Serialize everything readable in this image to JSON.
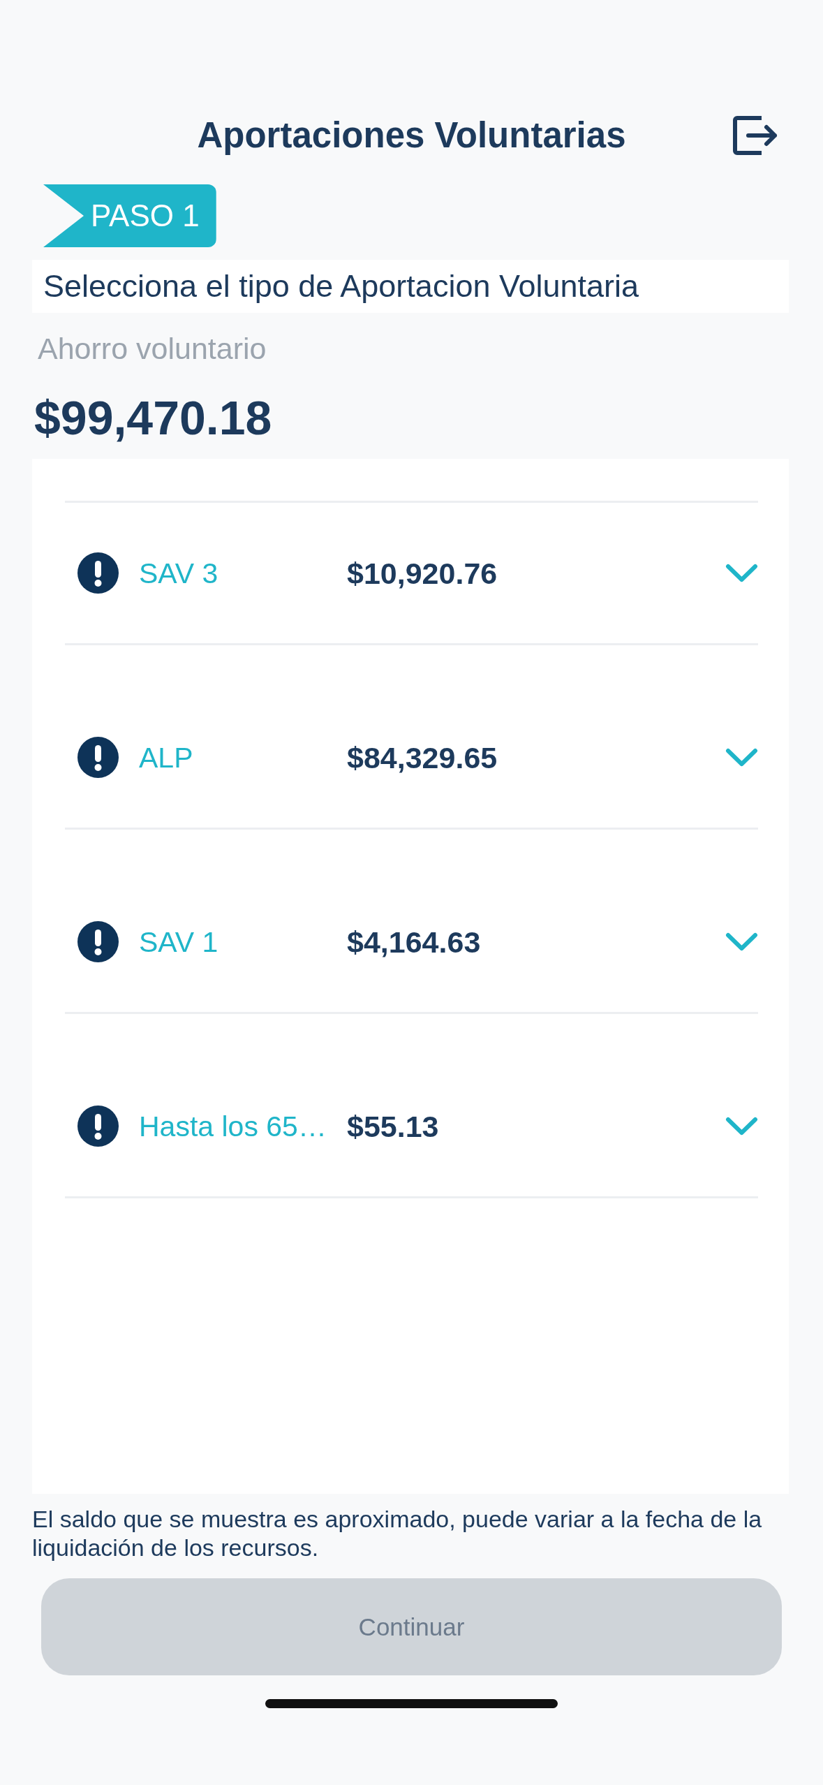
{
  "header": {
    "title": "Aportaciones Voluntarias"
  },
  "step": {
    "label": "PASO 1"
  },
  "instruction": "Selecciona el tipo de Aportacion Voluntaria",
  "balance": {
    "label": "Ahorro voluntario",
    "amount": "$99,470.18"
  },
  "accounts": [
    {
      "name": "SAV 3",
      "amount": "$10,920.76",
      "expanded": false
    },
    {
      "name": "ALP",
      "amount": "$84,329.65",
      "expanded": false
    },
    {
      "name": "SAV 1",
      "amount": "$4,164.63",
      "expanded": false
    },
    {
      "name": "Hasta los 65…",
      "amount": "$55.13",
      "expanded": false
    }
  ],
  "disclaimer": "El saldo que se muestra es aproximado, puede variar a la fecha de la liquidación de los recursos.",
  "continue_button": {
    "label": "Continuar",
    "disabled": true
  }
}
